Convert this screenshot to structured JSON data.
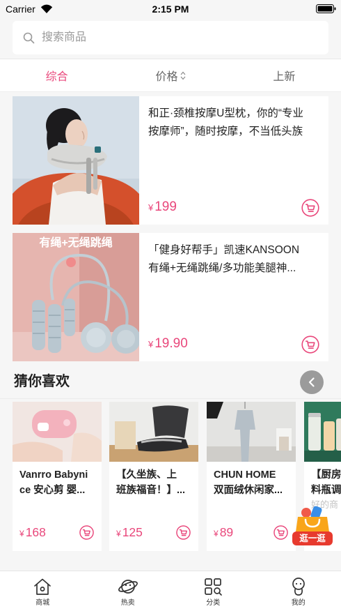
{
  "status_bar": {
    "carrier": "Carrier",
    "time": "2:15 PM",
    "wifi_icon": "wifi-icon",
    "battery_icon": "battery-icon"
  },
  "search": {
    "placeholder": "搜索商品",
    "icon": "search-icon"
  },
  "filters": [
    {
      "label": "综合",
      "active": true
    },
    {
      "label": "价格",
      "icon": "sort-arrows-icon"
    },
    {
      "label": "上新"
    }
  ],
  "products": [
    {
      "title_lines": [
        "和正·颈椎按摩U型枕，你的“专业",
        "按摩师”，随时按摩，不当低头族"
      ],
      "currency": "¥",
      "price": "199",
      "cart_icon": "cart-icon"
    },
    {
      "image_label": "有绳+无绳跳绳",
      "title_lines": [
        "「健身好帮手」凯速KANSOON",
        "有绳+无绳跳绳/多功能美腿神..."
      ],
      "currency": "¥",
      "price": "19.90",
      "cart_icon": "cart-icon"
    }
  ],
  "recommend": {
    "heading": "猜你喜欢",
    "scroll_icon": "chevron-left-icon",
    "items": [
      {
        "title_lines": [
          "Vanrro Babyni",
          "ce 安心剪 婴..."
        ],
        "currency": "¥",
        "price": "168"
      },
      {
        "title_lines": [
          "【久坐族、上",
          "班族福音！】..."
        ],
        "currency": "¥",
        "price": "125"
      },
      {
        "title_lines": [
          "CHUN HOME",
          "双面绒休闲家..."
        ],
        "currency": "¥",
        "price": "89"
      },
      {
        "title_lines": [
          "【厨房",
          "料瓶调"
        ],
        "subtitle": "好的商"
      }
    ]
  },
  "floating_badge": {
    "label": "逛一逛",
    "icon": "shopping-bag-icon"
  },
  "tab_bar": [
    {
      "label": "商城",
      "icon": "home-icon"
    },
    {
      "label": "热卖",
      "icon": "planet-icon"
    },
    {
      "label": "分类",
      "icon": "category-grid-icon"
    },
    {
      "label": "我的",
      "icon": "profile-icon"
    }
  ],
  "colors": {
    "accent": "#e9477b",
    "page_background": "#f6f6f6",
    "text": "#222222",
    "badge_red": "#e73a2e",
    "badge_orange": "#f9a51a"
  }
}
